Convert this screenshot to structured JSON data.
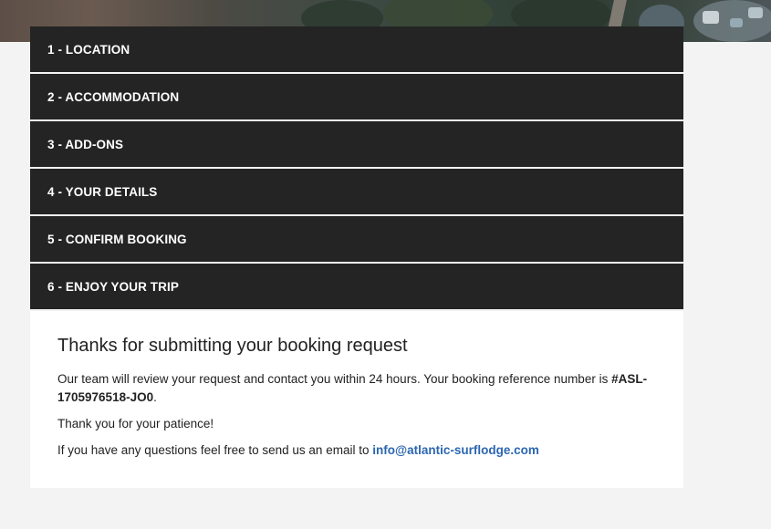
{
  "steps": [
    {
      "label": "1 - LOCATION"
    },
    {
      "label": "2 - ACCOMMODATION"
    },
    {
      "label": "3 - ADD-ONS"
    },
    {
      "label": "4 - YOUR DETAILS"
    },
    {
      "label": "5 - CONFIRM BOOKING"
    },
    {
      "label": "6 - ENJOY YOUR TRIP"
    }
  ],
  "confirmation": {
    "heading": "Thanks for submitting your booking request",
    "review_text": "Our team will review your request and contact you within 24 hours. Your booking reference number is ",
    "reference": "#ASL-1705976518-JO0",
    "period": ".",
    "patience_text": "Thank you for your patience!",
    "email_prefix": "If you have any questions feel free to send us an email to ",
    "email": "info@atlantic-surflodge.com"
  },
  "colors": {
    "step_bg": "#242424",
    "link": "#2b66b1",
    "page_bg": "#f3f3f3"
  }
}
